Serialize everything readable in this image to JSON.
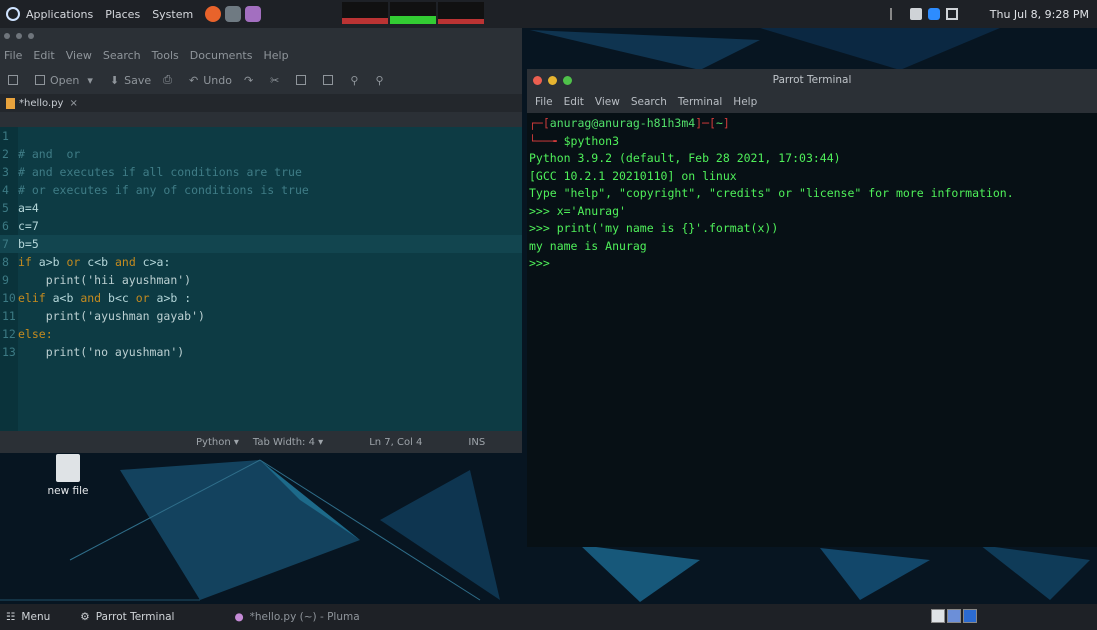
{
  "top_panel": {
    "menus": [
      "Applications",
      "Places",
      "System"
    ],
    "clock": "Thu Jul 8, 9:28 PM"
  },
  "pluma": {
    "menu": [
      "File",
      "Edit",
      "View",
      "Search",
      "Tools",
      "Documents",
      "Help"
    ],
    "toolbar": {
      "open": "Open",
      "save": "Save",
      "undo": "Undo"
    },
    "tab": {
      "title": "*hello.py"
    },
    "code": [
      {
        "n": "1",
        "parts": [
          {
            "t": "",
            "c": "tx"
          }
        ]
      },
      {
        "n": "2",
        "parts": [
          {
            "t": "# and  or",
            "c": "cmt"
          }
        ]
      },
      {
        "n": "3",
        "parts": [
          {
            "t": "# and executes if all conditions are true",
            "c": "cmt"
          }
        ]
      },
      {
        "n": "4",
        "parts": [
          {
            "t": "# or executes if any of conditions is true",
            "c": "cmt"
          }
        ]
      },
      {
        "n": "5",
        "parts": [
          {
            "t": "a=4",
            "c": "tx"
          }
        ]
      },
      {
        "n": "6",
        "parts": [
          {
            "t": "c=7",
            "c": "tx"
          }
        ]
      },
      {
        "n": "7",
        "parts": [
          {
            "t": "b=5",
            "c": "tx"
          }
        ],
        "current": true
      },
      {
        "n": "8",
        "parts": [
          {
            "t": "if",
            "c": "kw"
          },
          {
            "t": " a>b ",
            "c": "tx"
          },
          {
            "t": "or",
            "c": "kw"
          },
          {
            "t": " c<b ",
            "c": "tx"
          },
          {
            "t": "and",
            "c": "kw"
          },
          {
            "t": " c>a:",
            "c": "tx"
          }
        ]
      },
      {
        "n": "9",
        "parts": [
          {
            "t": "    print('hii ayushman')",
            "c": "str"
          }
        ]
      },
      {
        "n": "10",
        "parts": [
          {
            "t": "elif",
            "c": "kw"
          },
          {
            "t": " a<b ",
            "c": "tx"
          },
          {
            "t": "and",
            "c": "kw"
          },
          {
            "t": " b<c ",
            "c": "tx"
          },
          {
            "t": "or",
            "c": "kw"
          },
          {
            "t": " a>b :",
            "c": "tx"
          }
        ]
      },
      {
        "n": "11",
        "parts": [
          {
            "t": "    print('ayushman gayab')",
            "c": "str"
          }
        ]
      },
      {
        "n": "12",
        "parts": [
          {
            "t": "else:",
            "c": "kw"
          }
        ]
      },
      {
        "n": "13",
        "parts": [
          {
            "t": "    print('no ayushman')",
            "c": "str"
          }
        ]
      }
    ],
    "status": {
      "language": "Python",
      "tab_width": "Tab Width: 4",
      "position": "Ln 7, Col 4",
      "mode": "INS"
    }
  },
  "desktop": {
    "file_label": "new file"
  },
  "terminal": {
    "title": "Parrot Terminal",
    "menu": [
      "File",
      "Edit",
      "View",
      "Search",
      "Terminal",
      "Help"
    ],
    "prompt_user": "anurag@anurag-h81h3m4",
    "prompt_dir": "~",
    "command": "$python3",
    "lines": [
      "Python 3.9.2 (default, Feb 28 2021, 17:03:44)",
      "[GCC 10.2.1 20210110] on linux",
      "Type \"help\", \"copyright\", \"credits\" or \"license\" for more information.",
      ">>> x='Anurag'",
      ">>> print('my name is {}'.format(x))",
      "my name is Anurag",
      ">>>"
    ]
  },
  "bottom_panel": {
    "menu": "Menu",
    "tasks": [
      "Parrot Terminal",
      "*hello.py (~) - Pluma"
    ]
  },
  "colors": {
    "editor_bg": "#0d3b44",
    "terminal_green": "#4ff05a",
    "prompt_red": "#cf3b3b",
    "keyword": "#c58b1f"
  }
}
